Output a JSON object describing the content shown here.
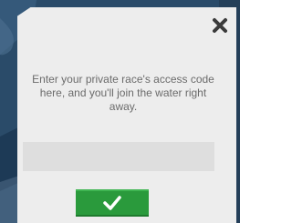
{
  "dialog": {
    "message": "Enter your private race's access code here, and you'll join the water right away.",
    "input": {
      "value": "",
      "placeholder": ""
    },
    "close_icon": "close-icon",
    "confirm_icon": "checkmark-icon"
  },
  "colors": {
    "dialog_background": "#ededed",
    "input_background": "#dedede",
    "confirm_button": "#2a9a3c",
    "message_text": "#6b6b6b",
    "backdrop": "#2c4e6e"
  }
}
